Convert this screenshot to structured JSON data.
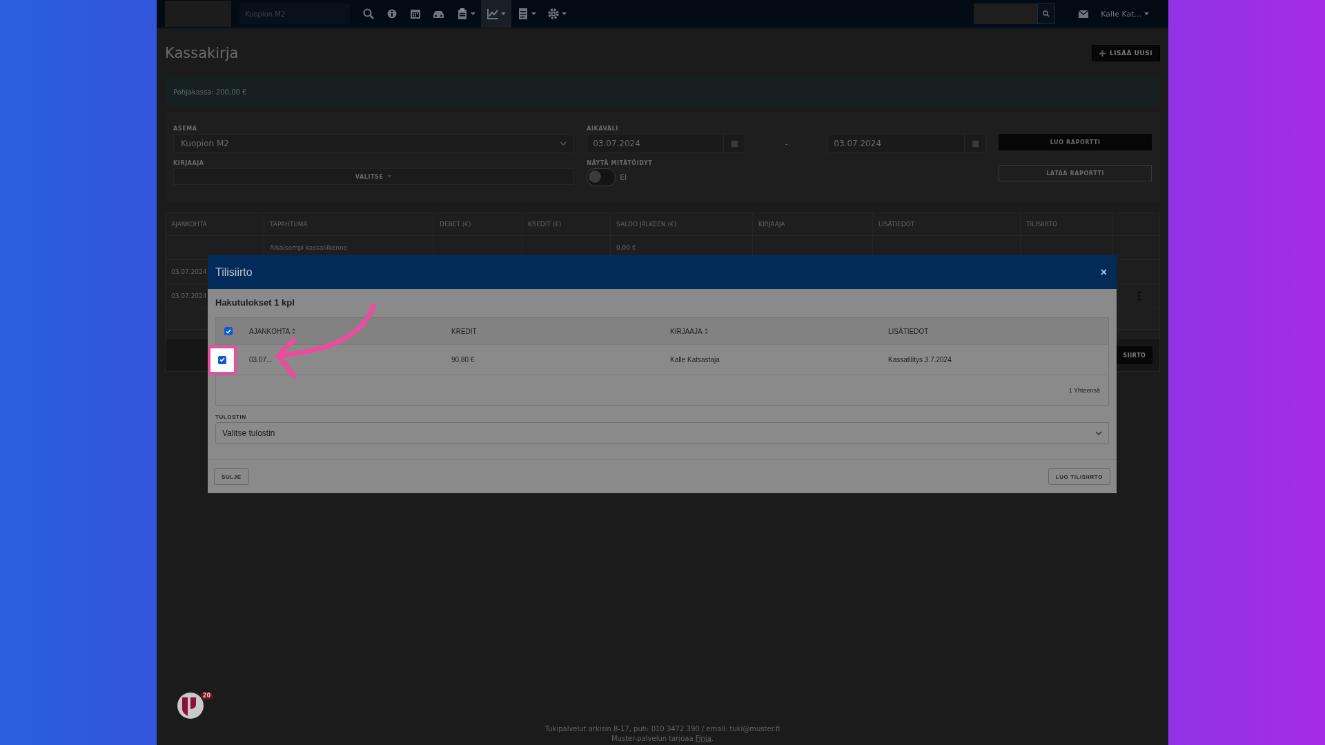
{
  "navbar": {
    "station": "Kuopion M2",
    "tools": [
      {
        "selected": false,
        "has_menu": false
      },
      {
        "selected": false,
        "has_menu": false
      },
      {
        "selected": false,
        "has_menu": false
      },
      {
        "selected": false,
        "has_menu": false
      },
      {
        "selected": false,
        "has_menu": true
      },
      {
        "selected": true,
        "has_menu": true
      },
      {
        "selected": false,
        "has_menu": true
      },
      {
        "selected": false,
        "has_menu": true
      }
    ],
    "user": "Kalle Kat..."
  },
  "page": {
    "title": "Kassakirja",
    "add_button": "LISÄÄ UUSI",
    "info": "Pohjakassa: 200,00 €"
  },
  "filters": {
    "station": {
      "label": "ASEMA",
      "value": "Kuopion M2"
    },
    "period": {
      "label": "AIKAVÄLI",
      "start": "03.07.2024",
      "separator": "-",
      "end": "03.07.2024"
    },
    "create_report": "LUO RAPORTTI",
    "recorder": {
      "label": "KIRJAAJA",
      "button": "VALITSE"
    },
    "show_voided": {
      "label": "NÄYTÄ MITÄTÖIDYT",
      "value": "EI",
      "on": false
    },
    "download_report": "LATAA RAPORTTI"
  },
  "table": {
    "columns": [
      "AJANKOHTA",
      "TAPAHTUMA",
      "DEBET (€)",
      "KREDIT (€)",
      "SALDO JÄLKEEN (€)",
      "KIRJAAJA",
      "LISÄTIEDOT",
      "TILISIIRTO"
    ],
    "rows": [
      [
        "",
        "Aikaisempi kassaliikenne",
        "",
        "",
        "0,00 €",
        "",
        "",
        ""
      ],
      [
        "03.07.2024",
        "",
        "",
        "",
        "",
        "",
        "",
        ""
      ],
      [
        "03.07.2024",
        "",
        "",
        "",
        "",
        "",
        "",
        ""
      ]
    ],
    "transfer_button": "SIIRTO"
  },
  "modal": {
    "title": "Tilisiirto",
    "close": "×",
    "results": "Hakutulokset 1 kpl",
    "select_all": true,
    "columns": [
      {
        "label": "AJANKOHTA",
        "sortable": true
      },
      {
        "label": "KREDIT",
        "sortable": false
      },
      {
        "label": "KIRJAAJA",
        "sortable": true
      },
      {
        "label": "LISÄTIEDOT",
        "sortable": false
      }
    ],
    "rows": [
      {
        "selected": true,
        "highlighted": true,
        "cells": [
          "03.07...",
          "90,80 €",
          "Kalle Katsastaja",
          "Kassatilitys 3.7.2024"
        ]
      }
    ],
    "total": "1 Yhteensä",
    "printer": {
      "label": "TULOSTIN",
      "value": "Valitse tulostin"
    },
    "close_button": "SULJE",
    "create_button": "LUO TILISIIRTO"
  },
  "footer": {
    "support": "Tukipalvelut arkisin 8-17, puh: 010 3472 390 / email: tuki@muster.fi",
    "provider_before": "Muster-palvelun tarjoaa ",
    "provider_link": "Finja",
    "provider_after": "."
  },
  "notification_count": "20"
}
